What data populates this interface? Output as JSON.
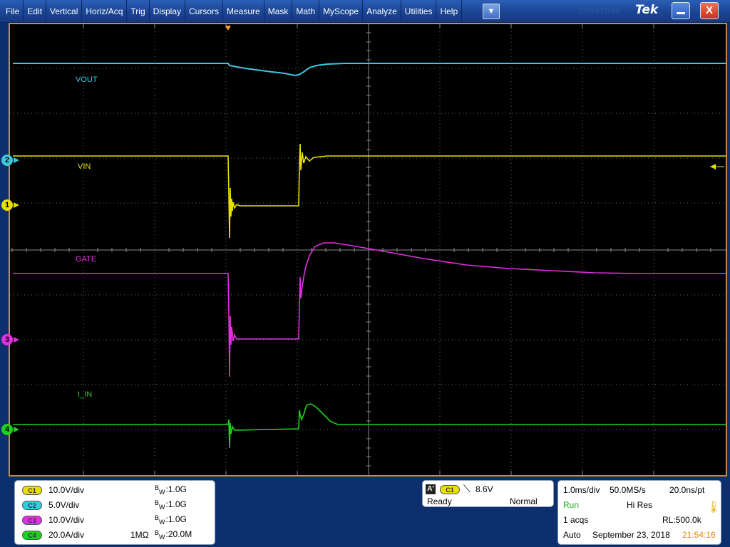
{
  "menu": {
    "items": [
      "File",
      "Edit",
      "Vertical",
      "Horiz/Acq",
      "Trig",
      "Display",
      "Cursors",
      "Measure",
      "Mask",
      "Math",
      "MyScope",
      "Analyze",
      "Utilities",
      "Help"
    ],
    "dropdown_glyph": "▼"
  },
  "brand": {
    "logo": "Tek",
    "watermark": "DPO4104B"
  },
  "window": {
    "minimize_icon": "minimize-icon",
    "close_label": "X"
  },
  "colors": {
    "ch1": "#e8e000",
    "ch2": "#3dc8e0",
    "ch3": "#e030e0",
    "ch4": "#20d020",
    "graticule": "#7a7a7a"
  },
  "traces": {
    "vout": "VOUT",
    "vin": "VIN",
    "gate": "GATE",
    "iin": "I_IN"
  },
  "markers": {
    "ch2": "2",
    "ch1": "1",
    "ch3": "3",
    "ch4": "4"
  },
  "channels": [
    {
      "pill": "C1",
      "scale": "10.0V/div",
      "impedance": "",
      "bw": "1.0G",
      "color": "#e8e000"
    },
    {
      "pill": "C2",
      "scale": "5.0V/div",
      "impedance": "",
      "bw": "1.0G",
      "color": "#3dc8e0"
    },
    {
      "pill": "C3",
      "scale": "10.0V/div",
      "impedance": "",
      "bw": "1.0G",
      "color": "#e030e0"
    },
    {
      "pill": "C4",
      "scale": "20.0A/div",
      "impedance": "1MΩ",
      "bw": "20.0M",
      "color": "#20d020"
    }
  ],
  "bw_letters": {
    "b": "B",
    "w": "W",
    "sep": ":"
  },
  "trigger": {
    "source_a": "A'",
    "source_pill": "C1",
    "slope_glyph": "⟍",
    "level": "8.6V",
    "state": "Ready",
    "mode": "Normal"
  },
  "horizontal": {
    "time_div": "1.0ms/div",
    "sample_rate": "50.0MS/s",
    "resolution": "20.0ns/pt",
    "run_state": "Run",
    "acq_mode": "Hi Res",
    "acqs": "1 acqs",
    "record_length": "RL:500.0k",
    "trigger_mode": "Auto",
    "date": "September 23, 2018",
    "time": "21:54:16"
  }
}
